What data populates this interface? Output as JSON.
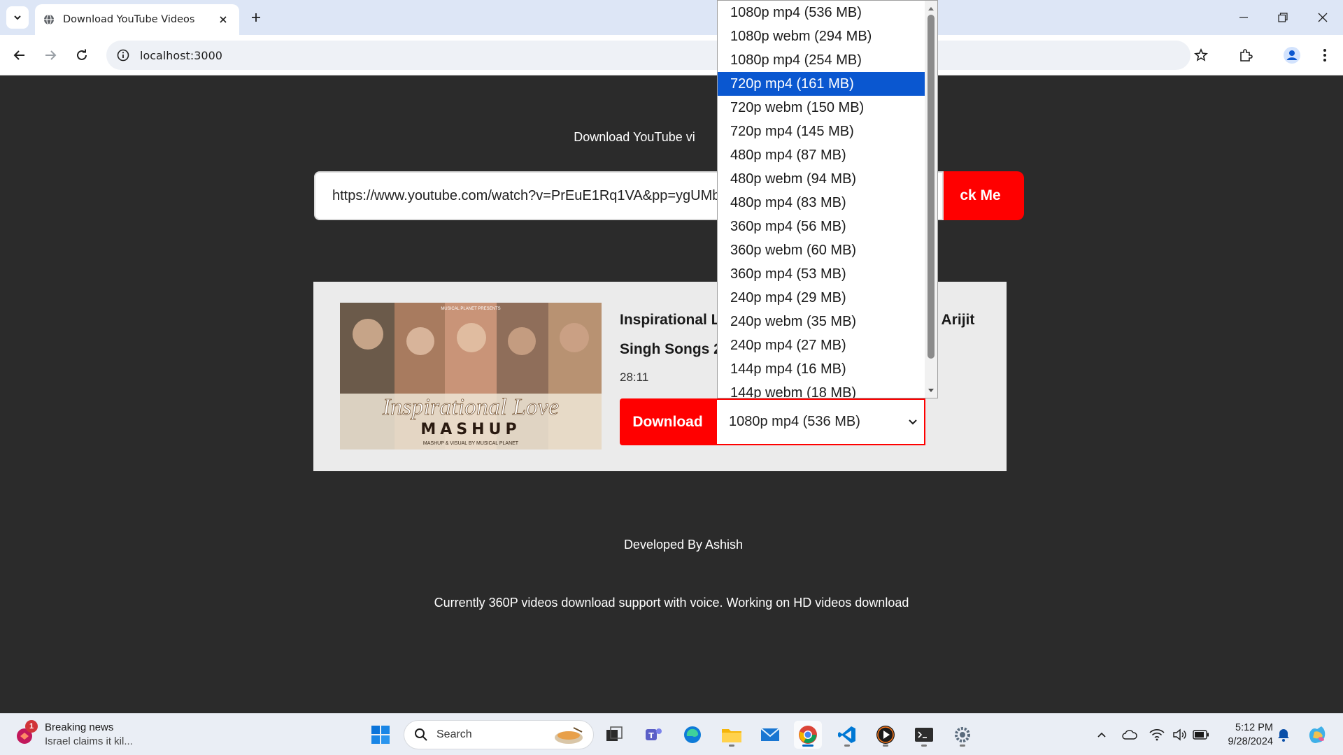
{
  "browser": {
    "tab_title": "Download YouTube Videos",
    "url": "localhost:3000"
  },
  "page": {
    "heading": "Download YouTube vi",
    "url_input_value": "https://www.youtube.com/watch?v=PrEuE1Rq1VA&pp=ygUMb",
    "click_button_label": "ck Me",
    "video": {
      "title": "Inspirational L                                              Arijit Singh Songs 2",
      "duration": "28:11",
      "thumbnail_caption": "Inspirational Love",
      "thumbnail_caption2": "MASHUP",
      "thumbnail_credit": "MASHUP & VISUAL BY MUSICAL PLANET",
      "thumbnail_presents": "MUSICAL PLANET PRESENTS"
    },
    "download_label": "Download",
    "selected_format": "1080p mp4 (536 MB)",
    "credit": "Developed By Ashish",
    "note": "Currently 360P videos download support with voice. Working on HD videos download"
  },
  "dropdown": {
    "options": [
      "1080p mp4 (536 MB)",
      "1080p webm (294 MB)",
      "1080p mp4 (254 MB)",
      "720p mp4 (161 MB)",
      "720p webm (150 MB)",
      "720p mp4 (145 MB)",
      "480p mp4 (87 MB)",
      "480p webm (94 MB)",
      "480p mp4 (83 MB)",
      "360p mp4 (56 MB)",
      "360p webm (60 MB)",
      "360p mp4 (53 MB)",
      "240p mp4 (29 MB)",
      "240p webm (35 MB)",
      "240p mp4 (27 MB)",
      "144p mp4 (16 MB)",
      "144p webm (18 MB)"
    ],
    "highlighted_index": 3
  },
  "taskbar": {
    "news_title": "Breaking news",
    "news_sub": "Israel claims it kil...",
    "news_badge": "1",
    "search_label": "Search",
    "time": "5:12 PM",
    "date": "9/28/2024"
  },
  "colors": {
    "accent_red": "#ff0000",
    "selection_blue": "#0a57d0",
    "page_bg": "#2b2b2b"
  }
}
